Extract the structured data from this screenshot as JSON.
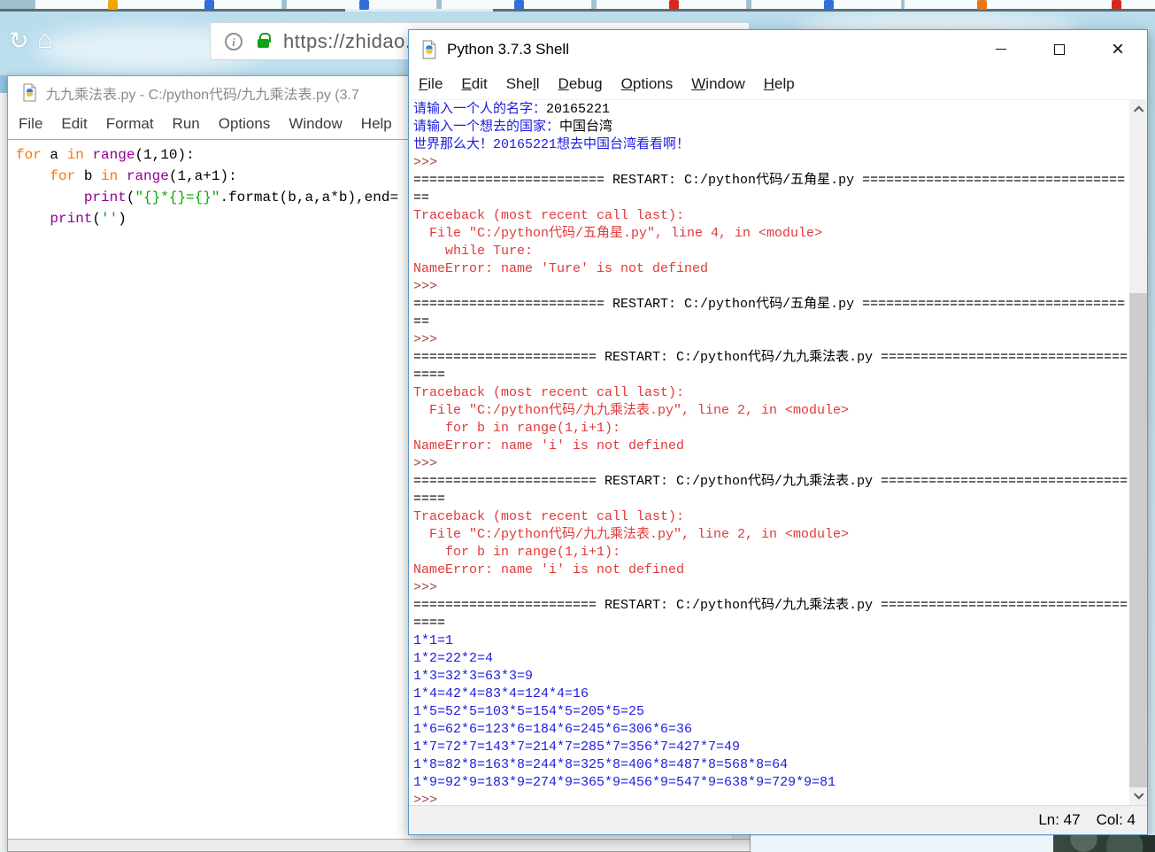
{
  "colors": {
    "stdout_blue": "#1c1ce0",
    "input_black": "#000000",
    "error_red": "#e03a3a",
    "prompt_brown": "#9a4646",
    "keyword_orange": "#ff7700",
    "builtin_purple": "#900090",
    "string_green": "#00aa00",
    "shell_border_blue": "#5a96ce",
    "lock_green": "#12a112"
  },
  "browser": {
    "url_text": "https://zhidao.",
    "info_icon_glyph": "i",
    "reload_icon_glyph": "↻",
    "home_icon_glyph": "⌂",
    "tabs": [
      {
        "favicon_color": "#f5a300"
      },
      {
        "favicon_color": "#2e6fdb"
      },
      {
        "favicon_color": "#2e6fdb"
      },
      {
        "favicon_color": "#2e6fdb"
      },
      {
        "favicon_color": "#d42a1e"
      },
      {
        "favicon_color": "#2e6fdb"
      },
      {
        "favicon_color": "#e87818"
      },
      {
        "favicon_color": "#d42a1e"
      }
    ]
  },
  "editor": {
    "title": "九九乘法表.py - C:/python代码/九九乘法表.py (3.7",
    "menu": [
      "File",
      "Edit",
      "Format",
      "Run",
      "Options",
      "Window",
      "Help"
    ],
    "code": [
      [
        {
          "t": "for",
          "c": "kw"
        },
        {
          "t": " a ",
          "c": "plain"
        },
        {
          "t": "in",
          "c": "kw"
        },
        {
          "t": " ",
          "c": "plain"
        },
        {
          "t": "range",
          "c": "builtin"
        },
        {
          "t": "(1,10):",
          "c": "plain"
        }
      ],
      [
        {
          "t": "    ",
          "c": "plain"
        },
        {
          "t": "for",
          "c": "kw"
        },
        {
          "t": " b ",
          "c": "plain"
        },
        {
          "t": "in",
          "c": "kw"
        },
        {
          "t": " ",
          "c": "plain"
        },
        {
          "t": "range",
          "c": "builtin"
        },
        {
          "t": "(1,a+1):",
          "c": "plain"
        }
      ],
      [
        {
          "t": "        ",
          "c": "plain"
        },
        {
          "t": "print",
          "c": "builtin"
        },
        {
          "t": "(",
          "c": "plain"
        },
        {
          "t": "\"{}*{}={}\"",
          "c": "str"
        },
        {
          "t": ".format(b,a,a*b),end=",
          "c": "plain"
        }
      ],
      [
        {
          "t": "    ",
          "c": "plain"
        },
        {
          "t": "print",
          "c": "builtin"
        },
        {
          "t": "(",
          "c": "plain"
        },
        {
          "t": "''",
          "c": "str"
        },
        {
          "t": ")",
          "c": "plain"
        }
      ]
    ]
  },
  "shell": {
    "title": "Python 3.7.3 Shell",
    "menu": [
      {
        "label": "File",
        "u": 0
      },
      {
        "label": "Edit",
        "u": 0
      },
      {
        "label": "Shell",
        "u": 3
      },
      {
        "label": "Debug",
        "u": 0
      },
      {
        "label": "Options",
        "u": 0
      },
      {
        "label": "Window",
        "u": 0
      },
      {
        "label": "Help",
        "u": 0
      }
    ],
    "status": {
      "ln_label": "Ln: 47",
      "col_label": "Col: 4"
    },
    "lines": [
      [
        {
          "t": "请输入一个人的名字：",
          "c": "out"
        },
        {
          "t": "20165221",
          "c": "in"
        }
      ],
      [
        {
          "t": "请输入一个想去的国家：",
          "c": "out"
        },
        {
          "t": "中国台湾",
          "c": "in"
        }
      ],
      [
        {
          "t": "世界那么大！20165221想去中国台湾看看啊！",
          "c": "out"
        }
      ],
      [
        {
          "t": ">>> ",
          "c": "prompt"
        }
      ],
      [
        {
          "t": "======================== RESTART: C:/python代码/五角星.py =================================",
          "c": "norm"
        }
      ],
      [
        {
          "t": "==",
          "c": "norm"
        }
      ],
      [
        {
          "t": "Traceback (most recent call last):",
          "c": "err"
        }
      ],
      [
        {
          "t": "  File \"C:/python代码/五角星.py\", line 4, in <module>",
          "c": "err"
        }
      ],
      [
        {
          "t": "    while Ture:",
          "c": "err"
        }
      ],
      [
        {
          "t": "NameError: name 'Ture' is not defined",
          "c": "err"
        }
      ],
      [
        {
          "t": ">>> ",
          "c": "prompt"
        }
      ],
      [
        {
          "t": "======================== RESTART: C:/python代码/五角星.py =================================",
          "c": "norm"
        }
      ],
      [
        {
          "t": "==",
          "c": "norm"
        }
      ],
      [
        {
          "t": ">>> ",
          "c": "prompt"
        }
      ],
      [
        {
          "t": "======================= RESTART: C:/python代码/九九乘法表.py ===============================",
          "c": "norm"
        }
      ],
      [
        {
          "t": "====",
          "c": "norm"
        }
      ],
      [
        {
          "t": "Traceback (most recent call last):",
          "c": "err"
        }
      ],
      [
        {
          "t": "  File \"C:/python代码/九九乘法表.py\", line 2, in <module>",
          "c": "err"
        }
      ],
      [
        {
          "t": "    for b in range(1,i+1):",
          "c": "err"
        }
      ],
      [
        {
          "t": "NameError: name 'i' is not defined",
          "c": "err"
        }
      ],
      [
        {
          "t": ">>> ",
          "c": "prompt"
        }
      ],
      [
        {
          "t": "======================= RESTART: C:/python代码/九九乘法表.py ===============================",
          "c": "norm"
        }
      ],
      [
        {
          "t": "====",
          "c": "norm"
        }
      ],
      [
        {
          "t": "Traceback (most recent call last):",
          "c": "err"
        }
      ],
      [
        {
          "t": "  File \"C:/python代码/九九乘法表.py\", line 2, in <module>",
          "c": "err"
        }
      ],
      [
        {
          "t": "    for b in range(1,i+1):",
          "c": "err"
        }
      ],
      [
        {
          "t": "NameError: name 'i' is not defined",
          "c": "err"
        }
      ],
      [
        {
          "t": ">>> ",
          "c": "prompt"
        }
      ],
      [
        {
          "t": "======================= RESTART: C:/python代码/九九乘法表.py ===============================",
          "c": "norm"
        }
      ],
      [
        {
          "t": "====",
          "c": "norm"
        }
      ],
      [
        {
          "t": "1*1=1",
          "c": "out"
        }
      ],
      [
        {
          "t": "1*2=22*2=4",
          "c": "out"
        }
      ],
      [
        {
          "t": "1*3=32*3=63*3=9",
          "c": "out"
        }
      ],
      [
        {
          "t": "1*4=42*4=83*4=124*4=16",
          "c": "out"
        }
      ],
      [
        {
          "t": "1*5=52*5=103*5=154*5=205*5=25",
          "c": "out"
        }
      ],
      [
        {
          "t": "1*6=62*6=123*6=184*6=245*6=306*6=36",
          "c": "out"
        }
      ],
      [
        {
          "t": "1*7=72*7=143*7=214*7=285*7=356*7=427*7=49",
          "c": "out"
        }
      ],
      [
        {
          "t": "1*8=82*8=163*8=244*8=325*8=406*8=487*8=568*8=64",
          "c": "out"
        }
      ],
      [
        {
          "t": "1*9=92*9=183*9=274*9=365*9=456*9=547*9=638*9=729*9=81",
          "c": "out"
        }
      ],
      [
        {
          "t": ">>> ",
          "c": "prompt"
        }
      ]
    ]
  }
}
